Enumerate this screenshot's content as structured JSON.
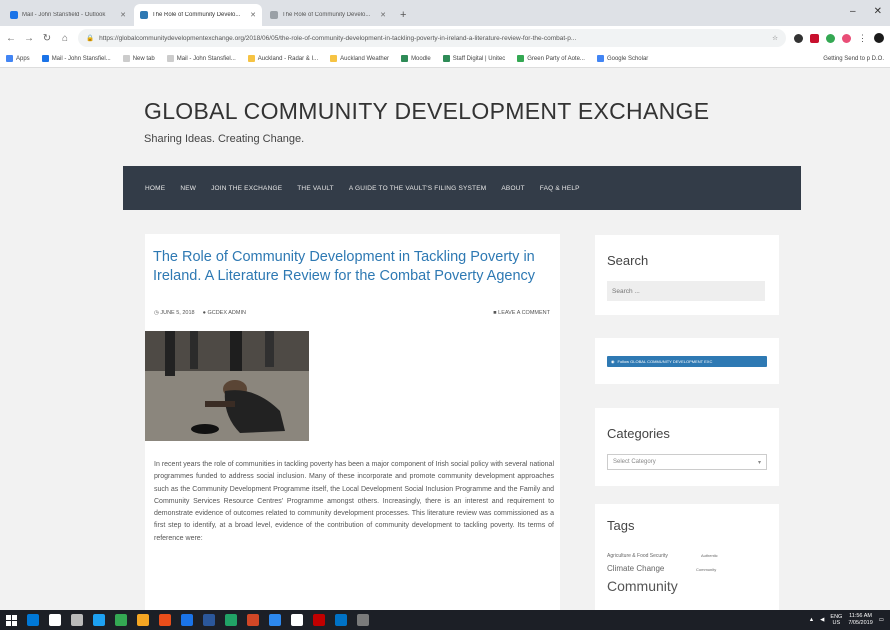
{
  "browser": {
    "tabs": [
      {
        "title": "Mail - John Stansfield - Outlook",
        "active": false,
        "color": "#1a73e8"
      },
      {
        "title": "The Role of Community Develo...",
        "active": true,
        "color": "#2e79b3"
      },
      {
        "title": "The Role of Community Develo...",
        "active": false,
        "color": "#9aa0a6"
      }
    ],
    "new_tab": "+",
    "window_controls": {
      "minimize": "–",
      "close": "✕"
    },
    "url": "https://globalcommunitydevelopmentexchange.org/2018/06/05/the-role-of-community-development-in-tackling-poverty-in-ireland-a-literature-review-for-the-combat-p...",
    "bookmarks": [
      {
        "label": "Apps",
        "color": "#4285f4"
      },
      {
        "label": "Mail - John Stansfiel...",
        "color": "#1a73e8"
      },
      {
        "label": "New tab",
        "color": "#cccccc"
      },
      {
        "label": "Mail - John Stansfiel...",
        "color": "#cccccc"
      },
      {
        "label": "Auckland - Radar & I...",
        "color": "#f6c343"
      },
      {
        "label": "Auckland Weather",
        "color": "#f6c343"
      },
      {
        "label": "Moodle",
        "color": "#2e8b57"
      },
      {
        "label": "Staff Digital | Unitec",
        "color": "#2e8b57"
      },
      {
        "label": "Green Party of Aote...",
        "color": "#34a853"
      },
      {
        "label": "Google Scholar",
        "color": "#4285f4"
      }
    ],
    "bookmarks_other": "Getting Send to p D.O."
  },
  "site": {
    "title": "GLOBAL COMMUNITY DEVELOPMENT EXCHANGE",
    "tagline": "Sharing Ideas. Creating Change.",
    "nav": [
      "HOME",
      "NEW",
      "JOIN THE EXCHANGE",
      "THE VAULT",
      "A GUIDE TO THE VAULT'S FILING SYSTEM",
      "ABOUT",
      "FAQ & HELP"
    ]
  },
  "post": {
    "title": "The Role of Community Development in Tackling Poverty in Ireland. A Literature Review for the Combat Poverty Agency",
    "date": "JUNE 5, 2018",
    "author": "GCDEX ADMIN",
    "comment_link": "LEAVE A COMMENT",
    "body": "In recent years the role of communities in tackling poverty has been a major component of Irish social policy with several national programmes funded to address social inclusion. Many of these incorporate and promote community development approaches such as the Community Development Programme itself, the Local Development Social Inclusion Programme and the Family and Community Services Resource Centres' Programme amongst others. Increasingly, there is an interest and requirement to demonstrate evidence of outcomes related to community development processes. This literature review was commissioned as a first step to identify, at a broad level, evidence of the contribution of community development to tackling poverty. Its terms of reference were:"
  },
  "sidebar": {
    "search_title": "Search",
    "search_placeholder": "Search ...",
    "follow_label": "Follow GLOBAL COMMUNITY DEVELOPMENT EXC",
    "categories_title": "Categories",
    "categories_select": "Select Category",
    "tags_title": "Tags",
    "tags": [
      "Agriculture & Food Security",
      "Authentic",
      "Climate Change",
      "Community",
      "Community"
    ]
  },
  "taskbar": {
    "apps": [
      "#0078d7",
      "#ffffff",
      "#bbbbbb",
      "#1da1f2",
      "#34a853",
      "#f5a623",
      "#e94e1b",
      "#1a73e8",
      "#2b579a",
      "#21a366",
      "#d24726",
      "#2d89ef",
      "#ffffff",
      "#c00000",
      "#0072c6",
      "#7a7a7a"
    ],
    "tray_lang": "ENG",
    "tray_region": "US",
    "time": "11:56 AM",
    "date": "7/05/2019"
  }
}
